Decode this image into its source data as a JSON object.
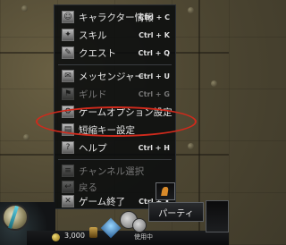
{
  "menu": {
    "items": [
      {
        "label": "キャラクター情報",
        "shortcut": "Ctrl + C",
        "icon": "character-icon",
        "enabled": true
      },
      {
        "label": "スキル",
        "shortcut": "Ctrl + K",
        "icon": "skill-icon",
        "enabled": true
      },
      {
        "label": "クエスト",
        "shortcut": "Ctrl + Q",
        "icon": "quest-icon",
        "enabled": true
      },
      {
        "label": "メッセンジャー",
        "shortcut": "Ctrl + U",
        "icon": "messenger-icon",
        "enabled": true
      },
      {
        "label": "ギルド",
        "shortcut": "Ctrl + G",
        "icon": "guild-icon",
        "enabled": false
      },
      {
        "label": "ゲームオプション設定",
        "shortcut": "",
        "icon": "options-icon",
        "enabled": true
      },
      {
        "label": "短縮キー設定",
        "shortcut": "",
        "icon": "keyboard-icon",
        "enabled": true
      },
      {
        "label": "ヘルプ",
        "shortcut": "Ctrl + H",
        "icon": "help-icon",
        "enabled": true
      },
      {
        "label": "チャンネル選択",
        "shortcut": "",
        "icon": "channel-icon",
        "enabled": false
      },
      {
        "label": "戻る",
        "shortcut": "",
        "icon": "back-icon",
        "enabled": false
      },
      {
        "label": "ゲーム終了",
        "shortcut": "Ctrl + X",
        "icon": "exit-icon",
        "enabled": true
      }
    ]
  },
  "hud": {
    "money": "3,000",
    "used_label": "使用中",
    "party_label": "パーティ"
  },
  "colors": {
    "highlight_ring": "#d02a1c",
    "menu_bg": "#0a0c0e",
    "text_enabled": "#e7e7e7",
    "text_disabled": "#767676"
  }
}
